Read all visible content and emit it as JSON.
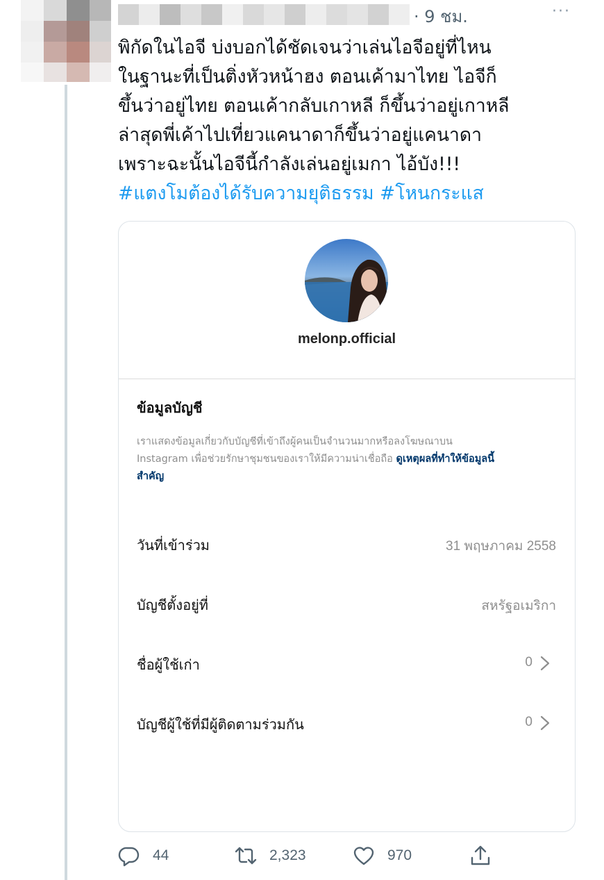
{
  "tweet": {
    "time": "· 9 ชม.",
    "more": "···",
    "lines": [
      "พิกัดในไอจี บ่งบอกได้ชัดเจนว่าเล่นไอจีอยู่ที่ไหน",
      "ในฐานะที่เป็นติ่งหัวหน้าฮง ตอนเค้ามาไทย ไอจีก็",
      "ขึ้นว่าอยู่ไทย ตอนเค้ากลับเกาหลี ก็ขึ้นว่าอยู่เกาหลี",
      "ล่าสุดพี่เค้าไปเที่ยวแคนาดาก็ขึ้นว่าอยู่แคนาดา",
      "เพราะฉะนั้นไอจีนี้กำลังเล่นอยู่เมกา ไอ้บัง!!!"
    ],
    "hashtags": [
      "#แตงโมต้องได้รับความยุติธรรม",
      "#โหนกระแส"
    ]
  },
  "card": {
    "username": "melonp.official",
    "section_title": "ข้อมูลบัญชี",
    "desc_lines": [
      "เราแสดงข้อมูลเกี่ยวกับบัญชีที่เข้าถึงผู้คนเป็นจำนวนมากหรือลงโฆษณาบน",
      "Instagram เพื่อช่วยรักษาชุมชนของเราให้มีความน่าเชื่อถือ "
    ],
    "desc_link_a": "ดูเหตุผลที่ทำให้ข้อมูลนี้",
    "desc_link_b": "สำคัญ",
    "rows": [
      {
        "label": "วันที่เข้าร่วม",
        "value": "31 พฤษภาคม 2558"
      },
      {
        "label": "บัญชีตั้งอยู่ที่",
        "value": "สหรัฐอเมริกา"
      },
      {
        "label": "ชื่อผู้ใช้เก่า",
        "value": "0"
      },
      {
        "label": "บัญชีผู้ใช้ที่มีผู้ติดตามร่วมกัน",
        "value": "0"
      }
    ]
  },
  "actions": {
    "replies": "44",
    "retweets": "2,323",
    "likes": "970"
  },
  "colors": {
    "link": "#1d9bf0",
    "muted": "#536471",
    "ig_link": "#00376b"
  }
}
